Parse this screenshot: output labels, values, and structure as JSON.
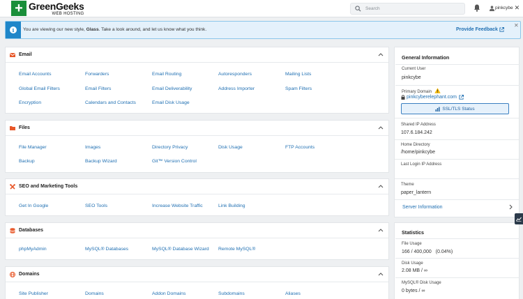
{
  "header": {
    "logo_name": "GreenGeeks",
    "logo_sub": "WEB HOSTING",
    "search_placeholder": "Search",
    "username": "pinkcybe"
  },
  "banner": {
    "msg_pre": "You are viewing our new style, ",
    "msg_bold": "Glass",
    "msg_post": ". Take a look around, and let us know what you think.",
    "feedback": "Provide Feedback"
  },
  "groups": {
    "email": {
      "title": "Email",
      "items": [
        "Email Accounts",
        "Forwarders",
        "Email Routing",
        "Autoresponders",
        "Mailing Lists",
        "Global Email Filters",
        "Email Filters",
        "Email Deliverability",
        "Address Importer",
        "Spam Filters",
        "Encryption",
        "Calendars and Contacts",
        "Email Disk Usage"
      ]
    },
    "files": {
      "title": "Files",
      "items": [
        "File Manager",
        "Images",
        "Directory Privacy",
        "Disk Usage",
        "FTP Accounts",
        "Backup",
        "Backup Wizard",
        "Git™ Version Control"
      ]
    },
    "seo": {
      "title": "SEO and Marketing Tools",
      "items": [
        "Get In Google",
        "SEO Tools",
        "Increase Website Traffic",
        "Link Building"
      ]
    },
    "databases": {
      "title": "Databases",
      "items": [
        "phpMyAdmin",
        "MySQL® Databases",
        "MySQL® Database Wizard",
        "Remote MySQL®"
      ]
    },
    "domains": {
      "title": "Domains",
      "items": [
        "Site Publisher",
        "Domains",
        "Addon Domains",
        "Subdomains",
        "Aliases"
      ]
    }
  },
  "general": {
    "title": "General Information",
    "current_user_label": "Current User",
    "current_user": "pinkcybe",
    "primary_domain_label": "Primary Domain",
    "primary_domain": "pinkcyberelephant.com",
    "ssl_button": "SSL/TLS Status",
    "shared_ip_label": "Shared IP Address",
    "shared_ip": "107.6.184.242",
    "home_dir_label": "Home Directory",
    "home_dir": "/home/pinkcybe",
    "last_login_label": "Last Login IP Address",
    "theme_label": "Theme",
    "theme": "paper_lantern",
    "server_info": "Server Information"
  },
  "statistics": {
    "title": "Statistics",
    "file_usage_label": "File Usage",
    "file_usage": "166 / 400,000   (0.04%)",
    "disk_usage_label": "Disk Usage",
    "disk_usage": "2.08 MB / ∞",
    "mysql_disk_label": "MySQL® Disk Usage",
    "mysql_disk": "0 bytes / ∞"
  },
  "colors": {
    "accent": "#1f6fb2",
    "brand": "#1a8f3a",
    "icon_orange": "#e8582a",
    "banner_bg": "#e4f1fb"
  }
}
